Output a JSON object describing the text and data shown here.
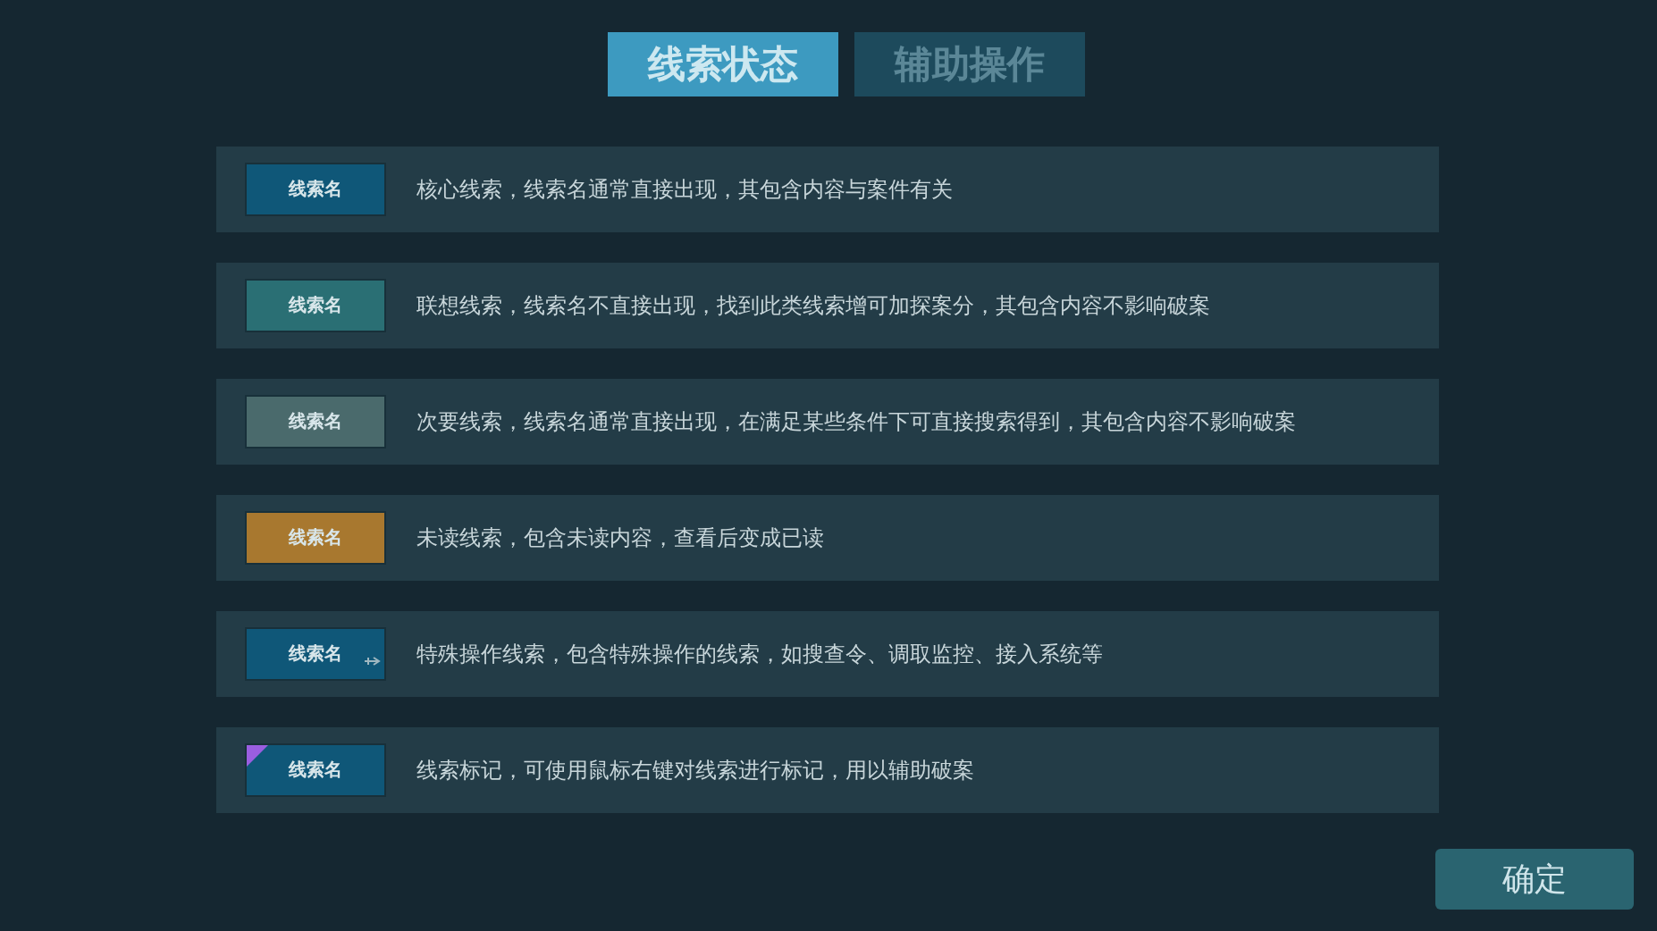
{
  "tabs": [
    {
      "label": "线索状态",
      "selected": true
    },
    {
      "label": "辅助操作",
      "selected": false
    }
  ],
  "rows": [
    {
      "tag": "线索名",
      "kind": "plain",
      "color": "#0f5778",
      "description": "核心线索，线索名通常直接出现，其包含内容与案件有关"
    },
    {
      "tag": "线索名",
      "kind": "plain",
      "color": "#2a6f74",
      "description": "联想线索，线索名不直接出现，找到此类线索增可加探案分，其包含内容不影响破案"
    },
    {
      "tag": "线索名",
      "kind": "plain",
      "color": "#4a6a6c",
      "description": "次要线索，线索名通常直接出现，在满足某些条件下可直接搜索得到，其包含内容不影响破案"
    },
    {
      "tag": "线索名",
      "kind": "plain",
      "color": "#a8782f",
      "description": "未读线索，包含未读内容，查看后变成已读"
    },
    {
      "tag": "线索名",
      "kind": "special",
      "color": "#0f5778",
      "description": "特殊操作线索，包含特殊操作的线索，如搜查令、调取监控、接入系统等"
    },
    {
      "tag": "线索名",
      "kind": "marked",
      "color": "#0f5778",
      "description": "线索标记，可使用鼠标右键对线索进行标记，用以辅助破案"
    }
  ],
  "confirm_button": "确定"
}
